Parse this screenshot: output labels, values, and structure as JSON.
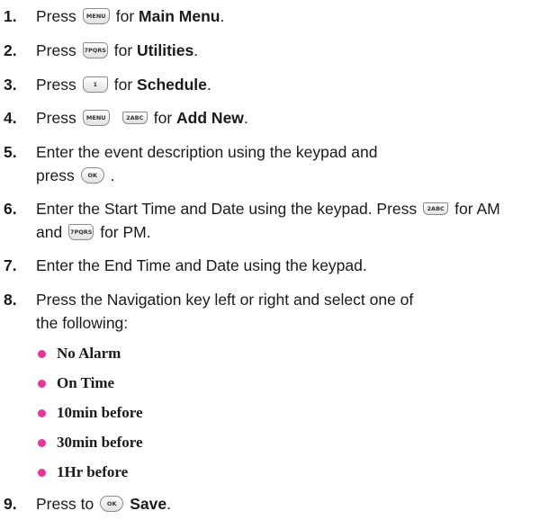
{
  "steps": [
    {
      "num": "1.",
      "pre": "Press",
      "keys": [
        "MENU"
      ],
      "post": "for",
      "bold": "Main Menu",
      "end": "."
    },
    {
      "num": "2.",
      "pre": "Press",
      "keys": [
        "7PQRS"
      ],
      "post": "for",
      "bold": "Utilities",
      "end": "."
    },
    {
      "num": "3.",
      "pre": "Press",
      "keys": [
        "1"
      ],
      "post": "for",
      "bold": "Schedule",
      "end": "."
    },
    {
      "num": "4.",
      "pre": "Press",
      "keys": [
        "MENU",
        "2ABC"
      ],
      "post": "for",
      "bold": "Add New",
      "end": "."
    },
    {
      "num": "5.",
      "line1": "Enter the event description using the keypad and",
      "line2_pre": "press",
      "keys": [
        "OK"
      ],
      "end": "."
    },
    {
      "num": "6.",
      "text": "Enter the Start Time and Date using the keypad. Press",
      "key1": "2ABC",
      "mid": "for AM",
      "line2_pre": "and",
      "key2": "7PQRS",
      "line2_post": "for PM."
    },
    {
      "num": "7.",
      "text": "Enter the End Time and Date using the keypad."
    },
    {
      "num": "8.",
      "line1": "Press the Navigation key left or right and select one of",
      "line2": "the following:"
    },
    {
      "num": "9.",
      "pre": "Press to",
      "keys": [
        "OK"
      ],
      "bold": "Save",
      "end": "."
    }
  ],
  "options": [
    "No Alarm",
    "On Time",
    "10min before",
    "30min before",
    "1Hr before"
  ],
  "colors": {
    "bullet": "#e5359a",
    "text": "#1a1a1a"
  }
}
